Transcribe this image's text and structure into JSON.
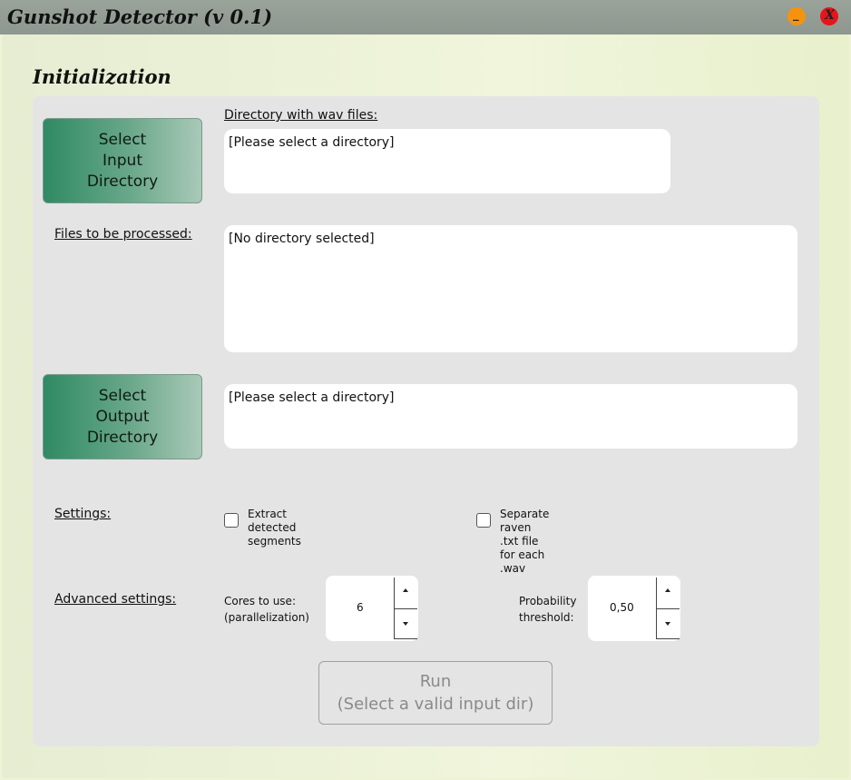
{
  "window": {
    "title": "Gunshot Detector (v 0.1)",
    "minimize_glyph": "_",
    "close_glyph": "X",
    "minimize_color": "#f5930f",
    "close_color": "#e8141a"
  },
  "section_title": "Initialization",
  "input_dir": {
    "button_lines": [
      "Select",
      "Input",
      "Directory"
    ],
    "label": "Directory with wav files:",
    "value": "[Please select a directory]"
  },
  "files": {
    "label": "Files to be processed:",
    "value": "[No directory selected]"
  },
  "output_dir": {
    "button_lines": [
      "Select",
      "Output",
      "Directory"
    ],
    "value": "[Please select a directory]"
  },
  "settings": {
    "label": "Settings:",
    "extract_segments": {
      "lines": [
        "Extract detected",
        "segments"
      ],
      "checked": false
    },
    "separate_raven": {
      "lines": [
        "Separate raven .txt file",
        "for each .wav"
      ],
      "checked": false
    }
  },
  "advanced": {
    "label": "Advanced settings:",
    "cores": {
      "lines": [
        "Cores to use:",
        "(parallelization)"
      ],
      "value": "6"
    },
    "probability": {
      "lines": [
        "Probability",
        "threshold:"
      ],
      "value": "0,50"
    }
  },
  "run_button": {
    "lines": [
      "Run",
      "(Select a valid input dir)"
    ],
    "enabled": false
  },
  "colors": {
    "button_green": "#2f8a64",
    "panel_gray": "#e4e4e4",
    "window_bg": "#eef3d6"
  }
}
